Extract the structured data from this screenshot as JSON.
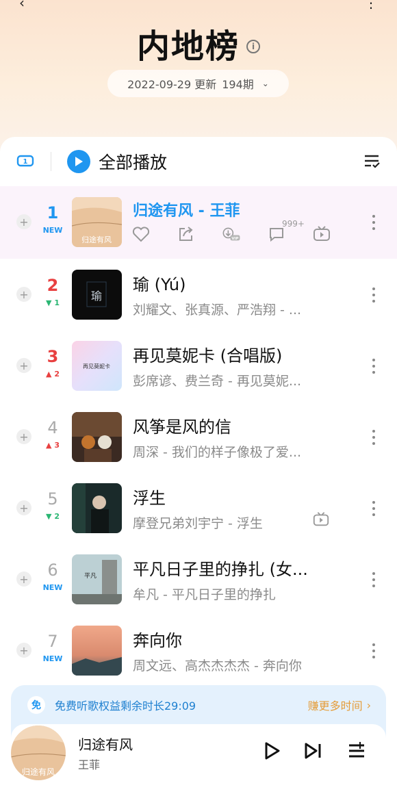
{
  "header": {
    "title": "内地榜",
    "issue_date": "2022-09-29 更新",
    "issue_no": "194期"
  },
  "toolbar": {
    "play_all_label": "全部播放"
  },
  "songs": [
    {
      "rank": "1",
      "change": "NEW",
      "change_type": "new",
      "title": "归途有风 - 王菲",
      "subtitle": "",
      "active": true,
      "comments": "999+",
      "rank_style": "blue"
    },
    {
      "rank": "2",
      "change": "1",
      "change_type": "down",
      "title": "瑜 (Yú)",
      "subtitle": "刘耀文、张真源、严浩翔 - ...",
      "rank_style": "red"
    },
    {
      "rank": "3",
      "change": "2",
      "change_type": "up",
      "title": "再见莫妮卡 (合唱版)",
      "subtitle": "彭席谚、费兰奇 - 再见莫妮...",
      "rank_style": "red"
    },
    {
      "rank": "4",
      "change": "3",
      "change_type": "up",
      "title": "风筝是风的信",
      "subtitle": "周深 - 我们的样子像极了爱...",
      "rank_style": "gray"
    },
    {
      "rank": "5",
      "change": "2",
      "change_type": "down",
      "title": "浮生",
      "subtitle": "摩登兄弟刘宇宁 - 浮生",
      "rank_style": "gray",
      "has_mv": true
    },
    {
      "rank": "6",
      "change": "NEW",
      "change_type": "new",
      "title": "平凡日子里的挣扎 (女...",
      "subtitle": "牟凡 - 平凡日子里的挣扎",
      "rank_style": "gray"
    },
    {
      "rank": "7",
      "change": "NEW",
      "change_type": "new",
      "title": "奔向你",
      "subtitle": "周文远、高杰杰杰杰 - 奔向你",
      "rank_style": "gray"
    }
  ],
  "free_bar": {
    "badge": "免",
    "text": "免费听歌权益剩余时长29:09",
    "earn_more": "赚更多时间"
  },
  "player": {
    "title": "归途有风",
    "artist": "王菲"
  },
  "colors": {
    "accent": "#1f96f0",
    "rank_red": "#e84040",
    "rank_up": "#e84040",
    "rank_down": "#2bb673",
    "earn": "#e59d3a"
  }
}
